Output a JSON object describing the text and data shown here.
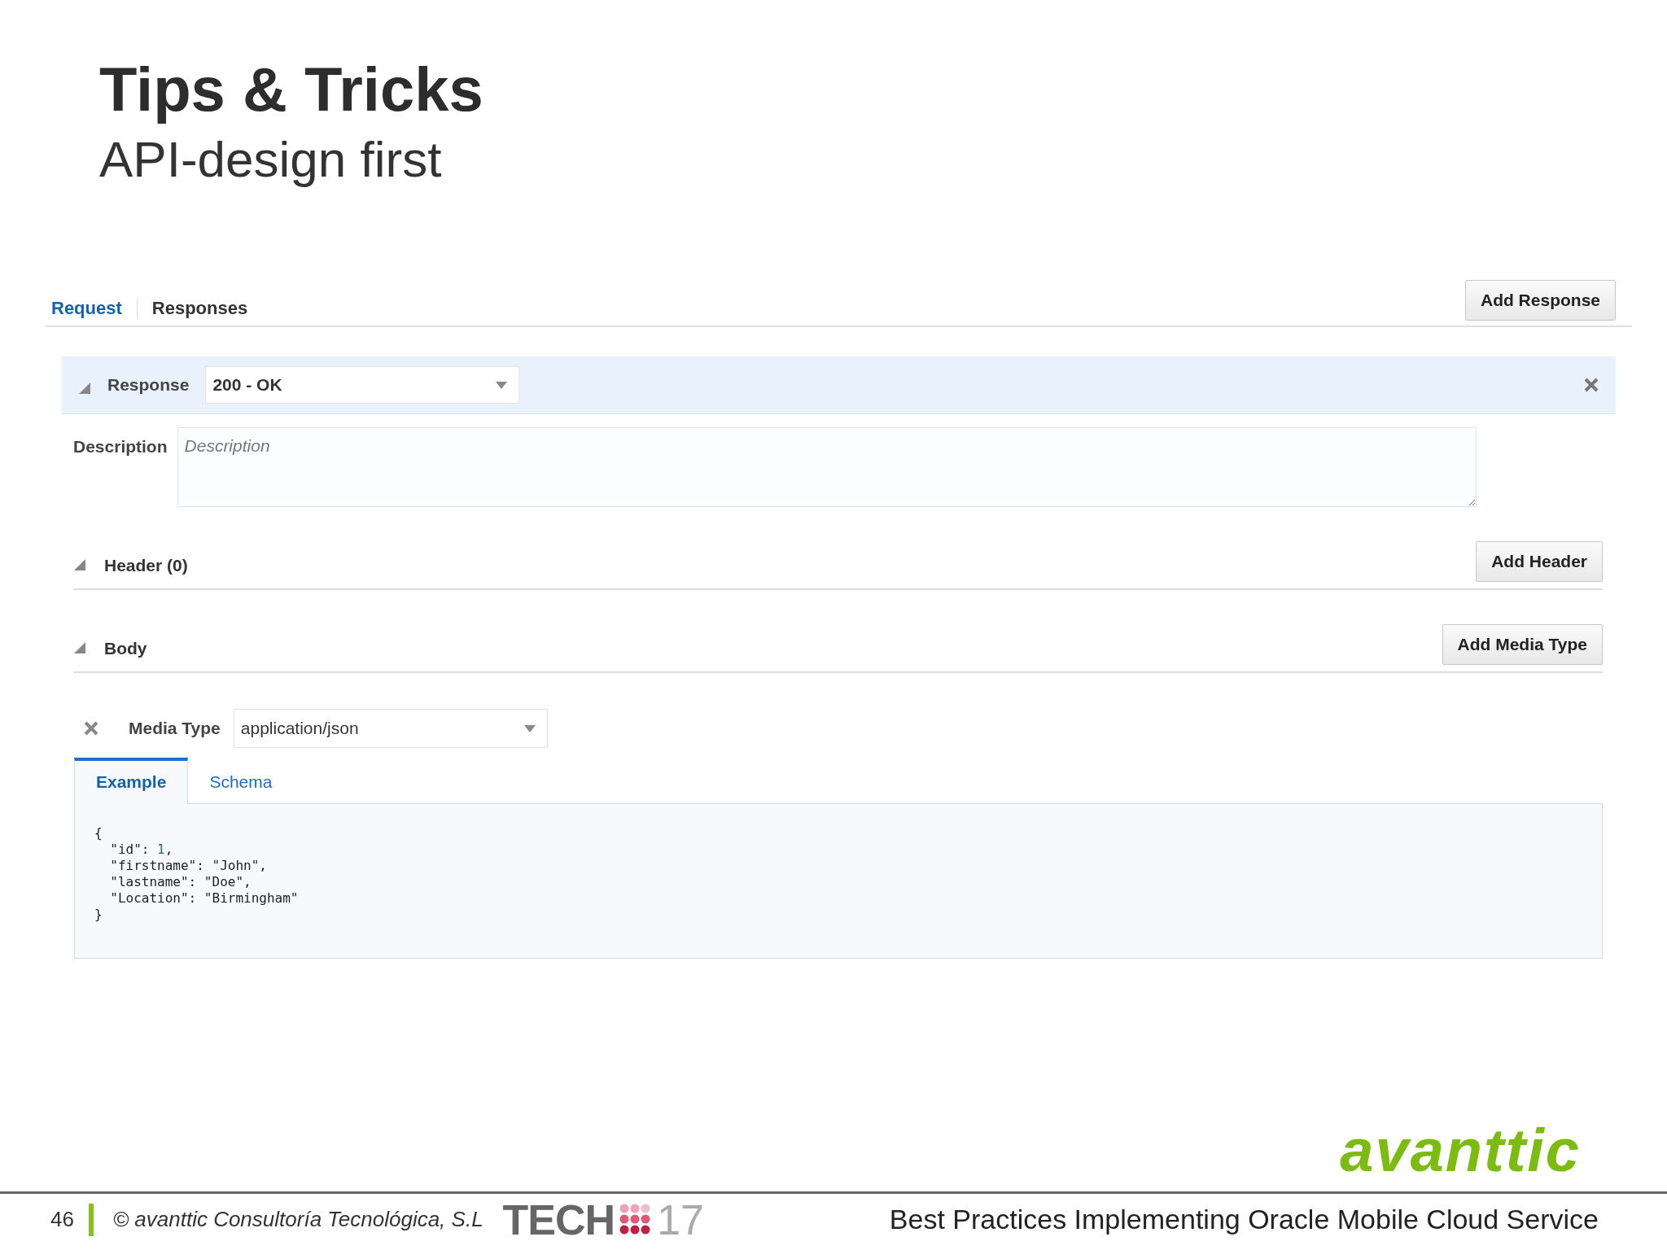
{
  "slide": {
    "title": "Tips & Tricks",
    "subtitle": "API-design first"
  },
  "tabs": [
    {
      "label": "Request",
      "selected": true
    },
    {
      "label": "Responses",
      "selected": false
    }
  ],
  "add_response_button": "Add Response",
  "response": {
    "expanded": true,
    "label": "Response",
    "value": "200 - OK"
  },
  "description": {
    "label": "Description",
    "placeholder": "Description"
  },
  "sections": [
    {
      "title": "Header (0)",
      "expanded": true,
      "button": "Add Header"
    },
    {
      "title": "Body",
      "expanded": true,
      "button": "Add Media Type"
    }
  ],
  "media_type": {
    "label": "Media Type",
    "value": "application/json"
  },
  "body_tabs": [
    {
      "label": "Example",
      "selected": true
    },
    {
      "label": "Schema",
      "selected": false
    }
  ],
  "code_lines": [
    [
      {
        "text": "{",
        "kind": "plain"
      }
    ],
    [
      {
        "text": "  \"id\": ",
        "kind": "plain"
      },
      {
        "text": "1",
        "kind": "number"
      },
      {
        "text": ",",
        "kind": "plain"
      }
    ],
    [
      {
        "text": "  \"firstname\": \"John\",",
        "kind": "plain"
      }
    ],
    [
      {
        "text": "  \"lastname\": \"Doe\",",
        "kind": "plain"
      }
    ],
    [
      {
        "text": "  \"Location\": \"Birmingham\"",
        "kind": "plain"
      }
    ],
    [
      {
        "text": "}",
        "kind": "plain"
      }
    ]
  ],
  "brand": "avanttic",
  "footer": {
    "page": "46",
    "copyright": "© avanttic Consultoría Tecnológica, S.L",
    "event_logo": [
      "TECH",
      "17"
    ],
    "talk_title": "Best Practices Implementing Oracle Mobile Cloud Service"
  }
}
